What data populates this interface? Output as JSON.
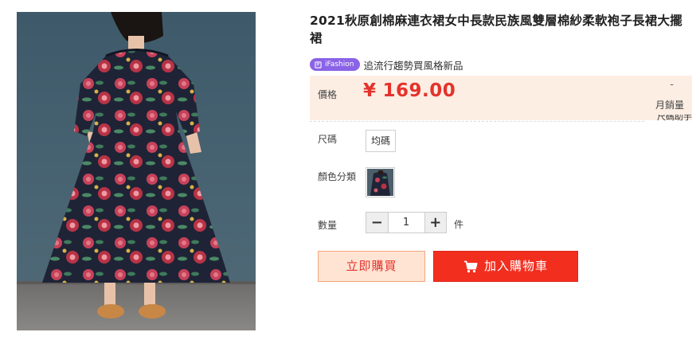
{
  "product": {
    "title": "2021秋原創棉麻連衣裙女中長款民族風雙層棉紗柔軟袍子長裙大擺裙",
    "image_alt": "floral dress photo"
  },
  "promo": {
    "badge_icon": "tag-icon",
    "badge_label": "iFashion",
    "badge_color": "#8a63e6",
    "text": "追流行趨勢買風格新品"
  },
  "price": {
    "label": "價格",
    "currency": "¥",
    "value": "169.00",
    "color": "#e4332b",
    "panel_color": "#fdeee4"
  },
  "sales": {
    "count": "-",
    "label": "月銷量"
  },
  "size_helper": {
    "label": "尺碼助手"
  },
  "options": {
    "size_label": "尺碼",
    "size_value": "均碼",
    "color_label": "顏色分類"
  },
  "quantity": {
    "label": "數量",
    "minus": "−",
    "value": "1",
    "plus": "+",
    "unit": "件"
  },
  "actions": {
    "buy_now": "立即購買",
    "add_to_cart": "加入購物車",
    "cart_icon": "shopping-cart-icon",
    "primary_color": "#f22e1f",
    "secondary_color": "#ffe4d4"
  }
}
